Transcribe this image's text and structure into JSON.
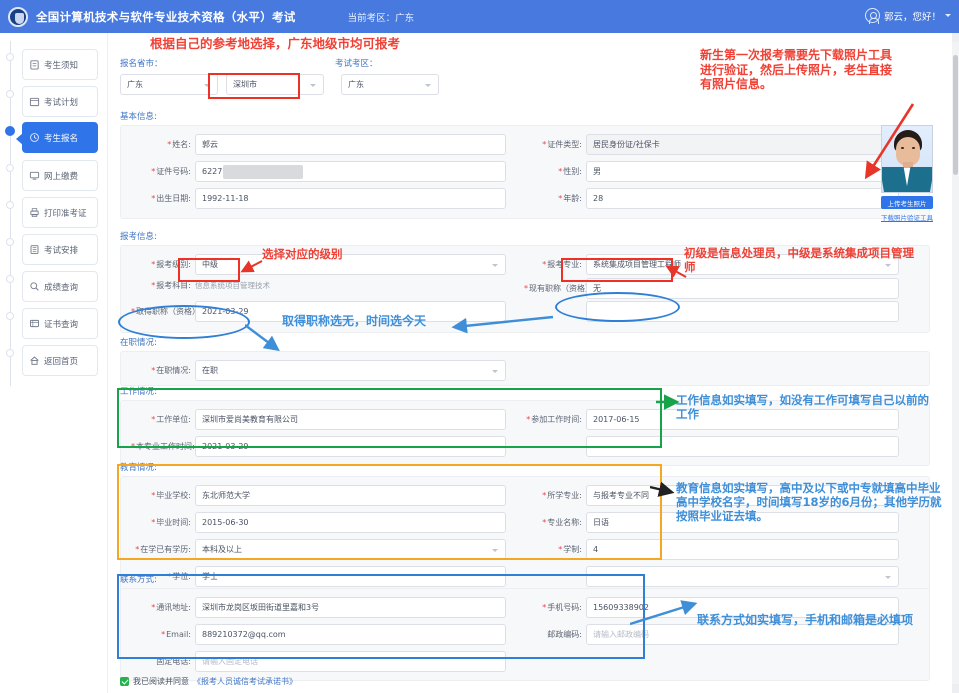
{
  "header": {
    "title": "全国计算机技术与软件专业技术资格（水平）考试",
    "region_label": "当前考区：",
    "region_value": "广东",
    "user_greeting": "郭云，您好！",
    "avatar_icon": "user-circle-icon",
    "caret_icon": "chevron-down-icon",
    "bg_color": "#4779df"
  },
  "sidebar": {
    "items": [
      {
        "label": "考生须知",
        "icon": "notice-icon",
        "active": false
      },
      {
        "label": "考试计划",
        "icon": "calendar-icon",
        "active": false
      },
      {
        "label": "考生报名",
        "icon": "clock-icon",
        "active": true
      },
      {
        "label": "网上缴费",
        "icon": "monitor-icon",
        "active": false
      },
      {
        "label": "打印准考证",
        "icon": "printer-icon",
        "active": false
      },
      {
        "label": "考试安排",
        "icon": "list-icon",
        "active": false
      },
      {
        "label": "成绩查询",
        "icon": "search-icon",
        "active": false
      },
      {
        "label": "证书查询",
        "icon": "certificate-icon",
        "active": false
      },
      {
        "label": "返回首页",
        "icon": "home-icon",
        "active": false
      }
    ],
    "active_color": "#2f74e8"
  },
  "top_selectors": {
    "signup_city_label": "报名省市：",
    "province_value": "广东",
    "city_value": "深圳市",
    "exam_area_label": "考试考区：",
    "exam_area_value": "广东"
  },
  "basic_info": {
    "section_title": "基本信息:",
    "name_label": "姓名:",
    "name_value": "郭云",
    "idtype_label": "证件类型:",
    "idtype_value": "居民身份证/社保卡",
    "idno_label": "证件号码:",
    "idno_value": "6227",
    "gender_label": "性别:",
    "gender_value": "男",
    "birth_label": "出生日期:",
    "birth_value": "1992-11-18",
    "age_label": "年龄:",
    "age_value": "28"
  },
  "photo": {
    "upload_button": "上传考生照片",
    "download_tool_link": "下载照片验证工具"
  },
  "exam_info": {
    "section_title": "报考信息:",
    "level_label": "报考级别:",
    "level_value": "中级",
    "major_label": "报考专业:",
    "major_value": "系统集成项目管理工程师",
    "subject_label": "报考科目:",
    "subject_value": "信息系统项目管理技术",
    "current_title_label": "现有职称（资格）:",
    "current_title_value": "无",
    "title_time_label": "取得职称（资格）时间:",
    "title_time_value": "2021-03-29"
  },
  "employment": {
    "section_title": "在职情况:",
    "status_label": "在职情况:",
    "status_value": "在职"
  },
  "work": {
    "section_title": "工作情况:",
    "company_label": "工作单位:",
    "company_value": "深圳市爱尚美教育有限公司",
    "start_work_label": "参加工作时间:",
    "start_work_value": "2017-06-15",
    "major_work_label": "本专业工作时间:",
    "major_work_value": "2021-03-29"
  },
  "education": {
    "section_title": "教育情况:",
    "school_label": "毕业学校:",
    "school_value": "东北师范大学",
    "study_major_label": "所学专业:",
    "study_major_value": "与报考专业不同",
    "grad_time_label": "毕业时间:",
    "grad_time_value": "2015-06-30",
    "major_name_label": "专业名称:",
    "major_name_value": "日语",
    "degree_edu_label": "在学已有学历:",
    "degree_edu_value": "本科及以上",
    "years_label": "学制:",
    "years_value": "4",
    "degree_label": "学位:",
    "degree_value": "学士"
  },
  "contact": {
    "section_title": "联系方式:",
    "address_label": "通讯地址:",
    "address_value": "深圳市龙岗区坂田街道里嘉和3号",
    "mobile_label": "手机号码:",
    "mobile_value": "15609338902",
    "email_label": "Email:",
    "email_value": "889210372@qq.com",
    "postcode_label": "邮政编码:",
    "postcode_placeholder": "请输入邮政编码",
    "phone_label": "固定电话:",
    "phone_placeholder": "请输入固定电话"
  },
  "agreement": {
    "checkbox_checked": true,
    "text": "我已阅读并同意",
    "link": "《报考人员诚信考试承诺书》"
  },
  "annotations": {
    "region_note": "根据自己的参考地选择，广东地级市均可报考",
    "photo_note": "新生第一次报考需要先下载照片工具\n进行验证，然后上传照片，老生直接\n有照片信息。",
    "level_note": "选择对应的级别",
    "major_note": "初级是信息处理员，中级是系统集成项目管理\n师",
    "title_note": "取得职称选无，时间选今天",
    "work_note": "工作信息如实填写，如没有工作可填写自己以前的\n工作",
    "edu_note": "教育信息如实填写，高中及以下或中专就填高中毕业\n高中学校名字，时间填写18岁的6月份；其他学历就\n按照毕业证去填。",
    "contact_note": "联系方式如实填写，手机和邮箱是必填项"
  }
}
